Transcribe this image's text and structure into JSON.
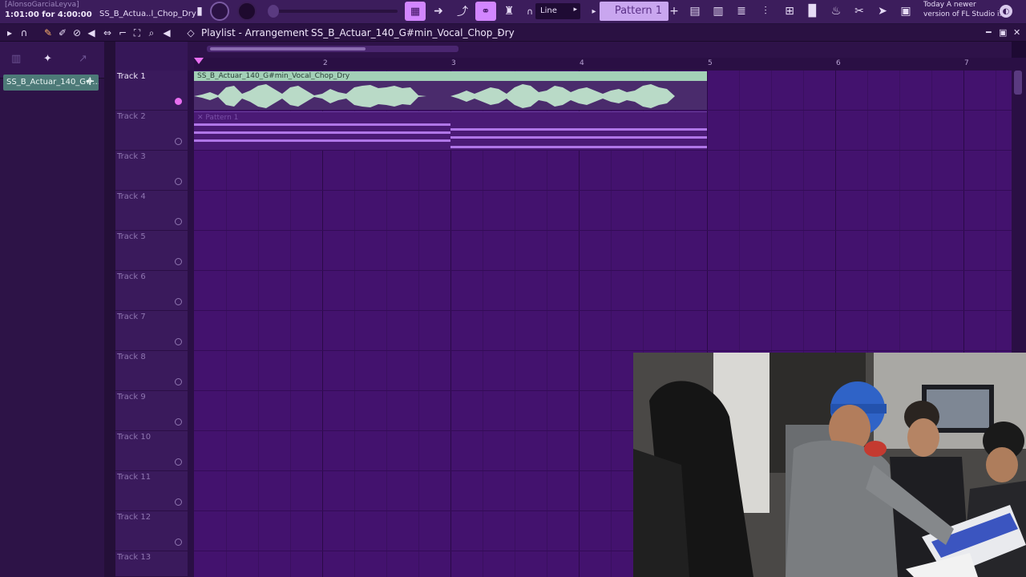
{
  "topbar": {
    "hint_user": "[AlonsoGarciaLeyva]",
    "time_position": "1:01:00 for 4:00:00",
    "song_name": "SS_B_Actua..l_Chop_Dry",
    "snap_mode": "Line",
    "pattern_selector": "Pattern 1",
    "news_line1": "Today  A newer",
    "news_line2": "version of FL Studio i..."
  },
  "window": {
    "title": "Playlist - Arrangement",
    "separator": "›",
    "current_clip": "SS_B_Actuar_140_G#min_Vocal_Chop_Dry",
    "trailing_arrow": "›"
  },
  "picker": {
    "selected_clip": "SS_B_Actuar_140_G#..."
  },
  "ruler": {
    "bars": [
      "2",
      "3",
      "4",
      "5",
      "6",
      "7"
    ]
  },
  "tracks": [
    "Track 1",
    "Track 2",
    "Track 3",
    "Track 4",
    "Track 5",
    "Track 6",
    "Track 7",
    "Track 8",
    "Track 9",
    "Track 10",
    "Track 11",
    "Track 12",
    "Track 13"
  ],
  "clips": {
    "audio_clip_name": "SS_B_Actuar_140_G#min_Vocal_Chop_Dry",
    "pattern_clip_name": "Pattern 1"
  },
  "colors": {
    "accent": "#d286ff",
    "audio_clip": "#a3d0b7",
    "grid": "#43126e",
    "topbar": "#3c1d5c"
  },
  "icons": {
    "toolbar": [
      "pattern-song-toggle-icon",
      "metronome-icon",
      "knob-icon",
      "piano-roll-icon",
      "arrow-icon",
      "draw-icon",
      "link-icon",
      "stamp-icon",
      "mixer-icon",
      "channel-rack-icon",
      "browser-icon",
      "plugin-icon",
      "download-icon",
      "cart-icon"
    ]
  }
}
